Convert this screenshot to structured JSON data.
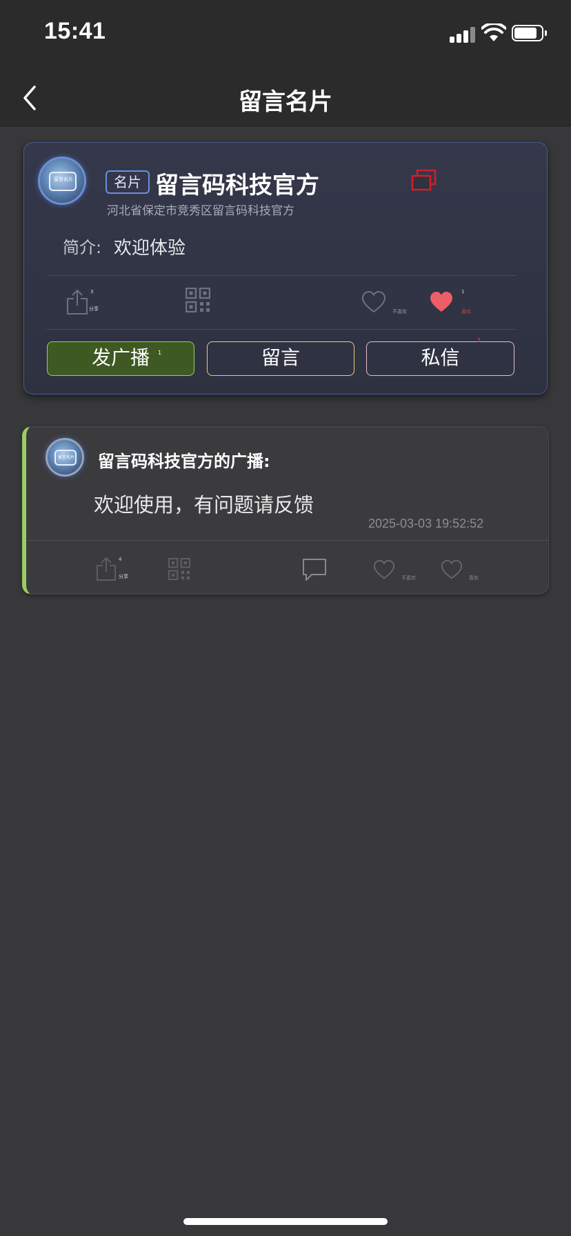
{
  "status_bar": {
    "time": "15:41"
  },
  "nav": {
    "title": "留言名片",
    "back_icon": "chevron-left-icon"
  },
  "profile": {
    "badge": "名片",
    "name": "留言码科技官方",
    "address": "河北省保定市竞秀区留言码科技官方",
    "intro_label": "简介:",
    "intro": "欢迎体验",
    "avatar_text": "留言名片",
    "share_label": "分享",
    "share_count": "3",
    "dislike_label": "不喜欢",
    "like_label": "喜欢",
    "like_count": "1",
    "accent_color": "#6b8fe0",
    "like_color": "#ee5e66",
    "copy_color": "#d41f26",
    "buttons": {
      "broadcast": "发广播",
      "broadcast_count": "1",
      "message": "留言",
      "private": "私信",
      "private_count": "2"
    }
  },
  "broadcast": {
    "author": "留言码科技官方的广播:",
    "content": "欢迎使用，有问题请反馈",
    "time": "2025-03-03 19:52:52",
    "avatar_text": "留言名片",
    "share_label": "分享",
    "share_count": "4",
    "dislike_label": "不喜欢",
    "like_label": "喜欢",
    "accent_color": "#9ccc65"
  }
}
